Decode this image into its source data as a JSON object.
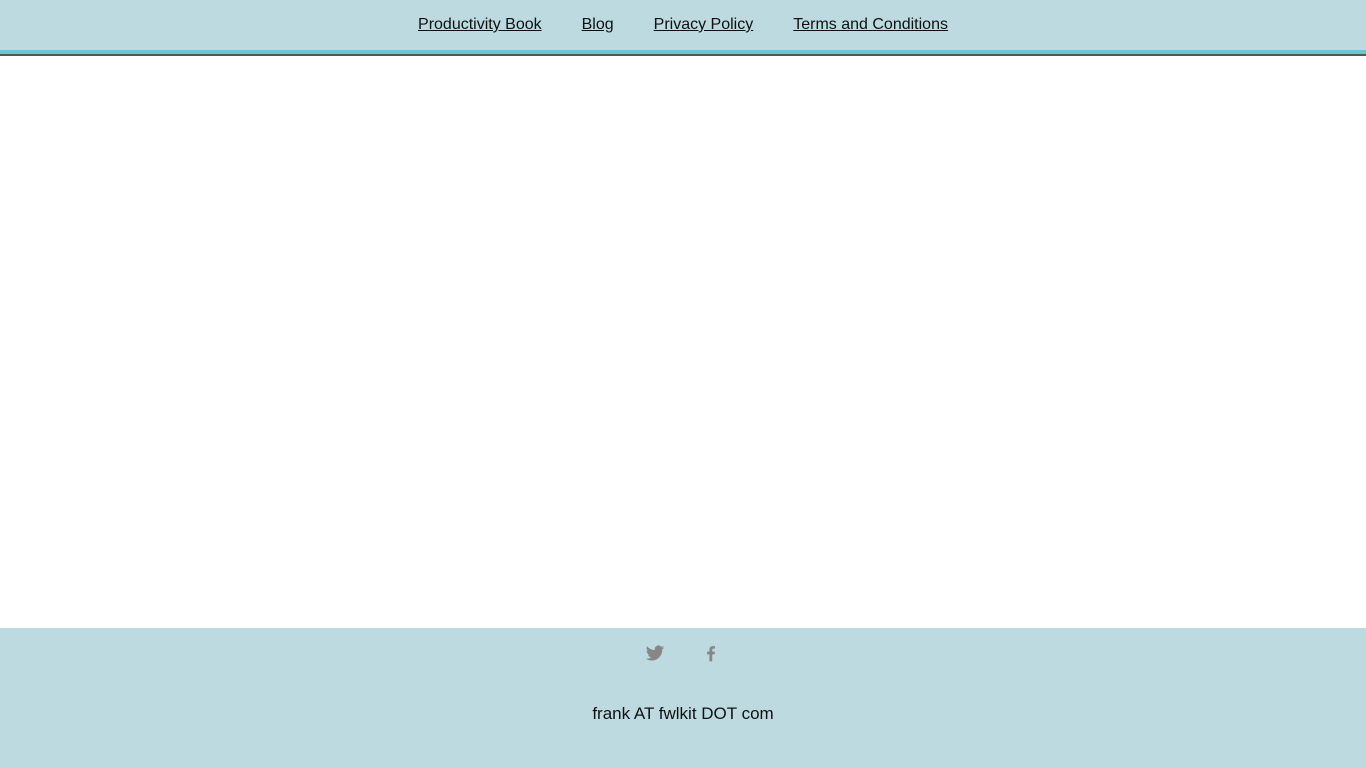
{
  "nav": {
    "items": [
      {
        "label": "Productivity Book"
      },
      {
        "label": "Blog"
      },
      {
        "label": "Privacy Policy"
      },
      {
        "label": "Terms and Conditions"
      }
    ]
  },
  "footer": {
    "social": [
      {
        "icon": "twitter-icon"
      },
      {
        "icon": "facebook-icon"
      }
    ],
    "contact_text": "frank AT fwlkit DOT com"
  },
  "colors": {
    "header_bg": "#bcdae0",
    "accent": "#6ec6d1",
    "rule": "#4d5a5c",
    "icon": "#8a8585",
    "text": "#111111"
  }
}
